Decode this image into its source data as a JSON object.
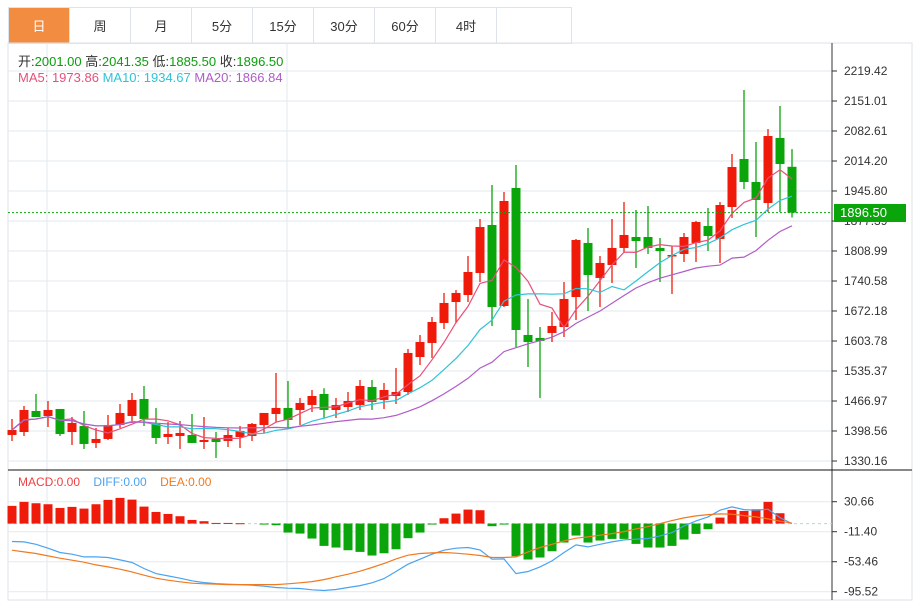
{
  "tabs": [
    {
      "label": "日",
      "active": true
    },
    {
      "label": "周",
      "active": false
    },
    {
      "label": "月",
      "active": false
    },
    {
      "label": "5分",
      "active": false
    },
    {
      "label": "15分",
      "active": false
    },
    {
      "label": "30分",
      "active": false
    },
    {
      "label": "60分",
      "active": false
    },
    {
      "label": "4时",
      "active": false
    }
  ],
  "ohlc_info": {
    "open_label": "开:",
    "open": "2001.00",
    "high_label": "高:",
    "high": "2041.35",
    "low_label": "低:",
    "low": "1885.50",
    "close_label": "收:",
    "close": "1896.50"
  },
  "ma_info": {
    "ma5": "MA5: 1973.86",
    "ma10": "MA10: 1934.67",
    "ma20": "MA20: 1866.84"
  },
  "macd_info": {
    "macd": "MACD:0.00",
    "diff": "DIFF:0.00",
    "dea": "DEA:0.00"
  },
  "last_price": "1896.50",
  "colors": {
    "up": "#f01a0a",
    "down": "#0aa50a",
    "active_tab": "#f28c40",
    "ma5": "#e8507a",
    "ma10": "#2ec4d8",
    "ma20": "#b05cc8",
    "diff": "#4aa3f0",
    "dea": "#f07a20"
  },
  "chart_data": [
    {
      "type": "candlestick",
      "y_ticks": [
        "2219.42",
        "2151.01",
        "2082.61",
        "2014.20",
        "1945.80",
        "1877.39",
        "1808.99",
        "1740.58",
        "1672.18",
        "1603.78",
        "1535.37",
        "1466.97",
        "1398.56",
        "1330.16"
      ],
      "ylim": [
        1330.16,
        2219.42
      ],
      "grid": true,
      "moving_averages": [
        5,
        10,
        20
      ],
      "ohlc": [
        [
          1389.5,
          1426.0,
          1375.8,
          1400.9
        ],
        [
          1396.3,
          1455.6,
          1387.2,
          1446.5
        ],
        [
          1444.2,
          1483.0,
          1430.5,
          1430.5
        ],
        [
          1432.8,
          1467.0,
          1407.7,
          1446.5
        ],
        [
          1448.8,
          1448.8,
          1387.2,
          1391.8
        ],
        [
          1396.3,
          1430.5,
          1366.7,
          1416.9
        ],
        [
          1410.0,
          1444.2,
          1357.6,
          1369.0
        ],
        [
          1371.3,
          1405.5,
          1359.9,
          1380.4
        ],
        [
          1380.4,
          1435.1,
          1378.1,
          1412.3
        ],
        [
          1412.3,
          1460.2,
          1405.5,
          1439.7
        ],
        [
          1432.8,
          1485.3,
          1416.9,
          1469.3
        ],
        [
          1471.6,
          1501.2,
          1410.0,
          1426.0
        ],
        [
          1414.6,
          1451.1,
          1369.0,
          1382.7
        ],
        [
          1384.9,
          1419.1,
          1369.0,
          1391.8
        ],
        [
          1387.2,
          1421.4,
          1357.6,
          1394.1
        ],
        [
          1389.5,
          1437.4,
          1371.3,
          1371.3
        ],
        [
          1373.5,
          1430.5,
          1357.6,
          1378.1
        ],
        [
          1380.4,
          1396.3,
          1337.1,
          1373.5
        ],
        [
          1375.8,
          1405.5,
          1362.1,
          1389.5
        ],
        [
          1384.9,
          1410.0,
          1359.9,
          1398.6
        ],
        [
          1387.2,
          1416.9,
          1375.8,
          1414.6
        ],
        [
          1412.3,
          1439.7,
          1394.1,
          1439.7
        ],
        [
          1437.4,
          1530.9,
          1419.1,
          1451.1
        ],
        [
          1451.1,
          1512.6,
          1405.5,
          1423.7
        ],
        [
          1446.5,
          1473.9,
          1412.3,
          1462.5
        ],
        [
          1457.9,
          1492.1,
          1441.9,
          1478.4
        ],
        [
          1483.0,
          1496.0,
          1428.3,
          1446.5
        ],
        [
          1446.5,
          1473.9,
          1428.3,
          1457.9
        ],
        [
          1453.3,
          1487.5,
          1441.9,
          1467.0
        ],
        [
          1457.9,
          1514.9,
          1446.5,
          1501.2
        ],
        [
          1498.9,
          1514.9,
          1446.5,
          1464.7
        ],
        [
          1469.3,
          1508.1,
          1448.8,
          1492.1
        ],
        [
          1478.4,
          1542.3,
          1460.2,
          1487.5
        ],
        [
          1487.5,
          1585.6,
          1480.7,
          1576.5
        ],
        [
          1567.3,
          1617.5,
          1549.1,
          1601.5
        ],
        [
          1599.3,
          1658.5,
          1565.1,
          1647.1
        ],
        [
          1644.9,
          1713.3,
          1631.2,
          1690.5
        ],
        [
          1692.7,
          1720.1,
          1644.9,
          1713.3
        ],
        [
          1708.7,
          1797.6,
          1692.7,
          1761.1
        ],
        [
          1758.9,
          1882.0,
          1738.3,
          1863.7
        ],
        [
          1868.3,
          1959.5,
          1638.0,
          1681.3
        ],
        [
          1683.6,
          1943.5,
          1681.3,
          1923.0
        ],
        [
          1952.7,
          2005.1,
          1590.1,
          1628.9
        ],
        [
          1617.5,
          1699.6,
          1544.5,
          1601.5
        ],
        [
          1610.7,
          1635.7,
          1473.9,
          1603.8
        ],
        [
          1622.1,
          1669.9,
          1601.5,
          1638.0
        ],
        [
          1635.7,
          1738.3,
          1612.9,
          1699.6
        ],
        [
          1704.1,
          1836.4,
          1651.7,
          1834.1
        ],
        [
          1827.3,
          1861.5,
          1672.2,
          1754.3
        ],
        [
          1747.5,
          1797.6,
          1681.3,
          1781.7
        ],
        [
          1777.1,
          1882.0,
          1736.1,
          1815.9
        ],
        [
          1815.9,
          1920.7,
          1806.7,
          1845.5
        ],
        [
          1840.9,
          1902.5,
          1770.3,
          1831.8
        ],
        [
          1840.9,
          1911.6,
          1802.2,
          1815.9
        ],
        [
          1815.9,
          1838.7,
          1738.3,
          1809.0
        ],
        [
          1797.6,
          1820.4,
          1711.0,
          1799.9
        ],
        [
          1802.2,
          1850.1,
          1783.9,
          1840.9
        ],
        [
          1827.3,
          1877.4,
          1783.9,
          1875.1
        ],
        [
          1866.0,
          1907.1,
          1809.0,
          1843.2
        ],
        [
          1836.4,
          1920.7,
          1781.7,
          1913.9
        ],
        [
          1909.3,
          2030.2,
          1884.3,
          2000.5
        ],
        [
          2018.8,
          2176.1,
          1950.4,
          1966.3
        ],
        [
          1966.3,
          2057.5,
          1840.9,
          1925.3
        ],
        [
          1918.5,
          2087.2,
          1897.9,
          2071.2
        ],
        [
          2066.7,
          2139.6,
          1897.9,
          2007.4
        ],
        [
          2001.0,
          2041.35,
          1885.5,
          1896.5
        ]
      ]
    },
    {
      "type": "macd",
      "y_ticks": [
        "30.66",
        "-11.40",
        "-53.46",
        "-95.52"
      ],
      "ylim": [
        -95.52,
        30.66
      ],
      "macd": [
        24.8,
        30.4,
        28.5,
        27.1,
        21.9,
        23.4,
        21.0,
        27.1,
        33.2,
        36.0,
        33.6,
        23.8,
        16.3,
        13.5,
        10.3,
        5.1,
        3.3,
        0.9,
        0.9,
        0.5,
        0,
        -0.5,
        -2.3,
        -12.6,
        -14.0,
        -21.0,
        -31.3,
        -33.6,
        -37.4,
        -39.7,
        -44.8,
        -41.6,
        -36.0,
        -20.5,
        -12.6,
        -1.4,
        7.5,
        14.0,
        19.6,
        18.7,
        -3.7,
        -1.4,
        -45.8,
        -50.4,
        -47.6,
        -38.8,
        -26.6,
        -16.8,
        -26.6,
        -23.8,
        -21.5,
        -21.5,
        -28.5,
        -33.6,
        -33.6,
        -31.3,
        -22.4,
        -14.5,
        -7.9,
        8.4,
        19.1,
        17.7,
        20.1,
        30.4,
        14.5,
        0
      ],
      "diff": [
        -25.2,
        -25.7,
        -29.0,
        -34.6,
        -40.6,
        -43.0,
        -46.7,
        -46.7,
        -47.6,
        -50.9,
        -54.6,
        -63.0,
        -70.1,
        -73.3,
        -76.6,
        -80.3,
        -82.7,
        -84.1,
        -85.0,
        -85.5,
        -86.4,
        -87.8,
        -89.7,
        -90.6,
        -91.1,
        -92.9,
        -93.9,
        -92.5,
        -89.7,
        -86.9,
        -83.1,
        -77.1,
        -67.2,
        -57.0,
        -50.0,
        -43.0,
        -37.4,
        -34.6,
        -33.6,
        -36.9,
        -50.0,
        -49.5,
        -70.1,
        -67.2,
        -60.7,
        -52.3,
        -40.6,
        -29.9,
        -32.7,
        -29.0,
        -25.7,
        -22.9,
        -21.9,
        -21.0,
        -17.3,
        -12.6,
        -3.3,
        3.7,
        9.3,
        18.7,
        23.4,
        19.6,
        18.7,
        20.1,
        8.4,
        0
      ],
      "dea": [
        -37.4,
        -39.7,
        -42.0,
        -45.3,
        -48.6,
        -51.4,
        -54.2,
        -57.9,
        -60.7,
        -64.0,
        -67.7,
        -72.4,
        -76.6,
        -79.4,
        -81.7,
        -83.6,
        -84.5,
        -85.0,
        -85.5,
        -85.5,
        -85.5,
        -85.5,
        -85.5,
        -84.5,
        -83.1,
        -81.3,
        -78.5,
        -74.7,
        -71.0,
        -66.8,
        -61.6,
        -56.0,
        -49.5,
        -44.4,
        -42.0,
        -41.1,
        -40.6,
        -41.6,
        -43.0,
        -44.8,
        -47.6,
        -47.6,
        -46.7,
        -39.7,
        -33.6,
        -29.0,
        -24.3,
        -20.5,
        -18.7,
        -16.3,
        -14.0,
        -11.2,
        -7.5,
        -4.2,
        0,
        4.2,
        7.9,
        10.7,
        12.6,
        13.5,
        13.1,
        11.2,
        9.3,
        6.5,
        3.3,
        0.5
      ]
    }
  ]
}
